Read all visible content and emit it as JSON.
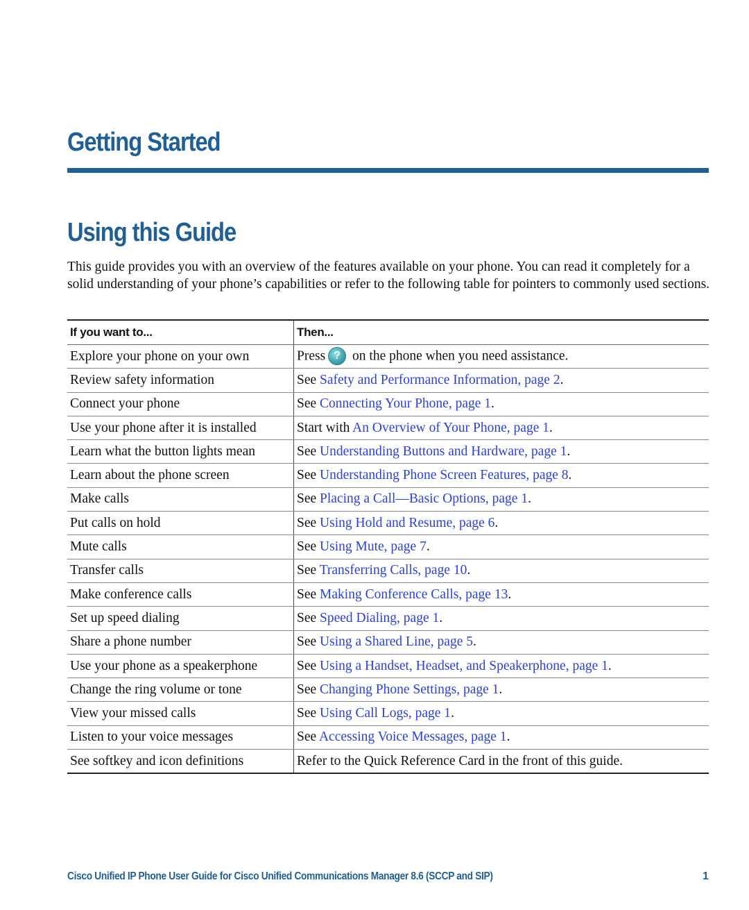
{
  "chapter_title": "Getting Started",
  "section_title": "Using this Guide",
  "intro": "This guide provides you with an overview of the features available on your phone. You can read it completely for a solid understanding of your phone’s capabilities or refer to the following table for pointers to commonly used sections.",
  "table": {
    "headers": [
      "If you want to...",
      "Then..."
    ],
    "rows": [
      {
        "want": "Explore your phone on your own",
        "prefix": "Press",
        "icon": "help-icon",
        "link": "",
        "suffix": "on the phone when you need assistance."
      },
      {
        "want": "Review safety information",
        "prefix": "See ",
        "link": "Safety and Performance Information, page 2",
        "suffix": "."
      },
      {
        "want": "Connect your phone",
        "prefix": "See ",
        "link": "Connecting Your Phone, page 1",
        "suffix": "."
      },
      {
        "want": "Use your phone after it is installed",
        "prefix": "Start with ",
        "link": "An Overview of Your Phone, page 1",
        "suffix": "."
      },
      {
        "want": "Learn what the button lights mean",
        "prefix": "See ",
        "link": "Understanding Buttons and Hardware, page 1",
        "suffix": "."
      },
      {
        "want": "Learn about the phone screen",
        "prefix": "See ",
        "link": "Understanding Phone Screen Features, page 8",
        "suffix": "."
      },
      {
        "want": "Make calls",
        "prefix": "See ",
        "link": "Placing a Call—Basic Options, page 1",
        "suffix": "."
      },
      {
        "want": "Put calls on hold",
        "prefix": "See ",
        "link": "Using Hold and Resume, page 6",
        "suffix": "."
      },
      {
        "want": "Mute calls",
        "prefix": "See ",
        "link": "Using Mute, page 7",
        "suffix": "."
      },
      {
        "want": "Transfer calls",
        "prefix": "See ",
        "link": "Transferring Calls, page 10",
        "suffix": "."
      },
      {
        "want": "Make conference calls",
        "prefix": "See ",
        "link": "Making Conference Calls, page 13",
        "suffix": "."
      },
      {
        "want": "Set up speed dialing",
        "prefix": "See ",
        "link": "Speed Dialing, page 1",
        "suffix": "."
      },
      {
        "want": "Share a phone number",
        "prefix": "See ",
        "link": "Using a Shared Line, page 5",
        "suffix": "."
      },
      {
        "want": "Use your phone as a speakerphone",
        "prefix": "See ",
        "link": "Using a Handset, Headset, and Speakerphone, page 1",
        "suffix": "."
      },
      {
        "want": "Change the ring volume or tone",
        "prefix": "See ",
        "link": "Changing Phone Settings, page 1",
        "suffix": "."
      },
      {
        "want": "View your missed calls",
        "prefix": "See ",
        "link": "Using Call Logs, page 1",
        "suffix": "."
      },
      {
        "want": "Listen to your voice messages",
        "prefix": "See ",
        "link": "Accessing Voice Messages, page 1",
        "suffix": "."
      },
      {
        "want": "See softkey and icon definitions",
        "prefix": "Refer to the Quick Reference Card in the front of this guide.",
        "link": "",
        "suffix": ""
      }
    ]
  },
  "help_icon_glyph": "?",
  "footer": {
    "text": "Cisco Unified IP Phone User Guide for Cisco Unified Communications Manager 8.6 (SCCP and SIP)",
    "page_number": "1"
  },
  "colors": {
    "heading": "#1f5f96",
    "link": "#2a3fe0"
  }
}
